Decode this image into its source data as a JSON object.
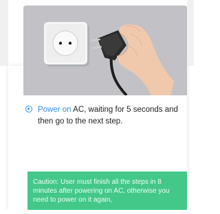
{
  "step": {
    "link_text": "Power on",
    "text": " AC, waiting for 5 seconds and then go to the next step."
  },
  "caution": {
    "text": "Caution: User must finish all the steps in 8 minutes after powering on AC, otherwise you need to power on it again,"
  },
  "illustration": {
    "name": "plug-into-socket-image"
  },
  "colors": {
    "accent": "#2f8fe8",
    "caution_bg": "#44c88a"
  }
}
